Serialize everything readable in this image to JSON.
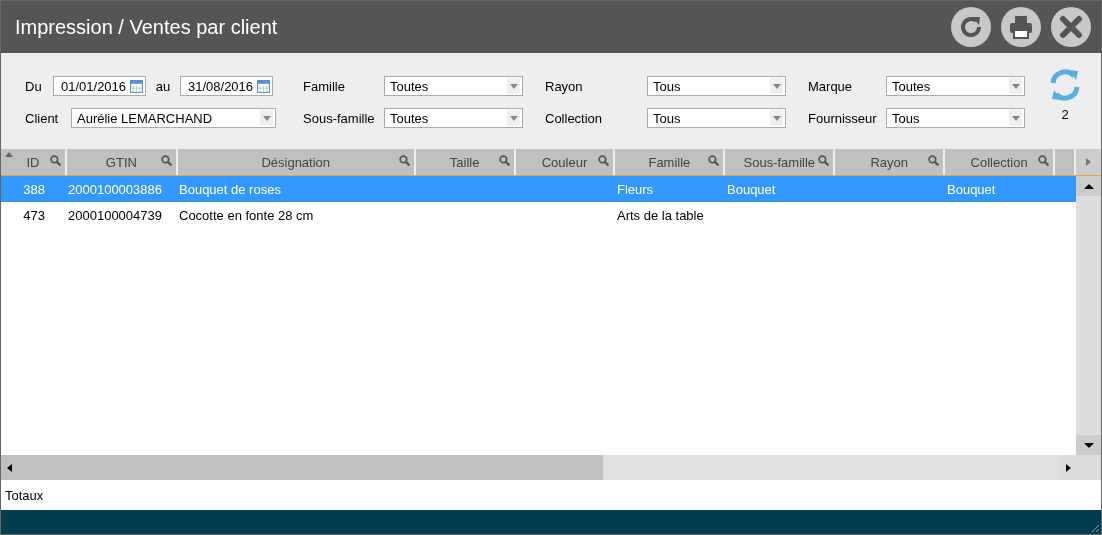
{
  "window": {
    "title": "Impression / Ventes par client"
  },
  "filters": {
    "date_from": {
      "label": "Du",
      "value": "01/01/2016"
    },
    "date_to": {
      "label": "au",
      "value": "31/08/2016"
    },
    "client": {
      "label": "Client",
      "value": "Aurélie LEMARCHAND"
    },
    "dropdowns": [
      {
        "label": "Famille",
        "value": "Toutes"
      },
      {
        "label": "Rayon",
        "value": "Tous"
      },
      {
        "label": "Marque",
        "value": "Toutes"
      },
      {
        "label": "Sous-famille",
        "value": "Toutes"
      },
      {
        "label": "Collection",
        "value": "Tous"
      },
      {
        "label": "Fournisseur",
        "value": "Tous"
      }
    ],
    "count": "2"
  },
  "table": {
    "columns": [
      "ID",
      "GTIN",
      "Désignation",
      "Taille",
      "Couleur",
      "Famille",
      "Sous-famille",
      "Rayon",
      "Collection"
    ],
    "rows": [
      {
        "selected": true,
        "cells": [
          "388",
          "2000100003886",
          "Bouquet de roses",
          "",
          "",
          "Fleurs",
          "Bouquet",
          "",
          "Bouquet"
        ]
      },
      {
        "selected": false,
        "cells": [
          "473",
          "2000100004739",
          "Cocotte en fonte 28 cm",
          "",
          "",
          "Arts de la table",
          "",
          "",
          ""
        ]
      }
    ]
  },
  "totals_label": "Totaux"
}
